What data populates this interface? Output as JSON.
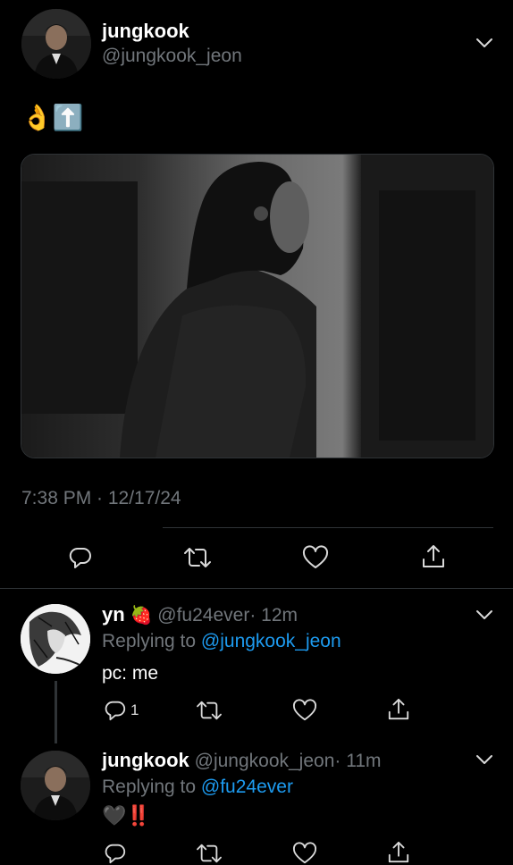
{
  "tweet": {
    "author_name": "jungkook",
    "author_handle": "@jungkook_jeon",
    "emojis": "👌⬆️",
    "timestamp": "7:38 PM · 12/17/24"
  },
  "reply1": {
    "author_name": "yn",
    "author_emoji": "🍓",
    "author_handle": "@fu24ever",
    "time": "· 12m",
    "replying_prefix": "Replying to",
    "replying_handle": "@jungkook_jeon",
    "text": "pc: me",
    "reply_count": "1"
  },
  "reply2": {
    "author_name": "jungkook",
    "author_handle": "@jungkook_jeon",
    "time": "· 11m",
    "replying_prefix": "Replying to",
    "replying_handle": "@fu24ever",
    "text": "🖤‼️"
  },
  "colors": {
    "background": "#000000",
    "link": "#1d9bf0",
    "muted": "#71767b",
    "divider": "#2f3336"
  },
  "icons": [
    "chevron-down-icon",
    "reply-icon",
    "retweet-icon",
    "like-icon",
    "share-icon"
  ]
}
